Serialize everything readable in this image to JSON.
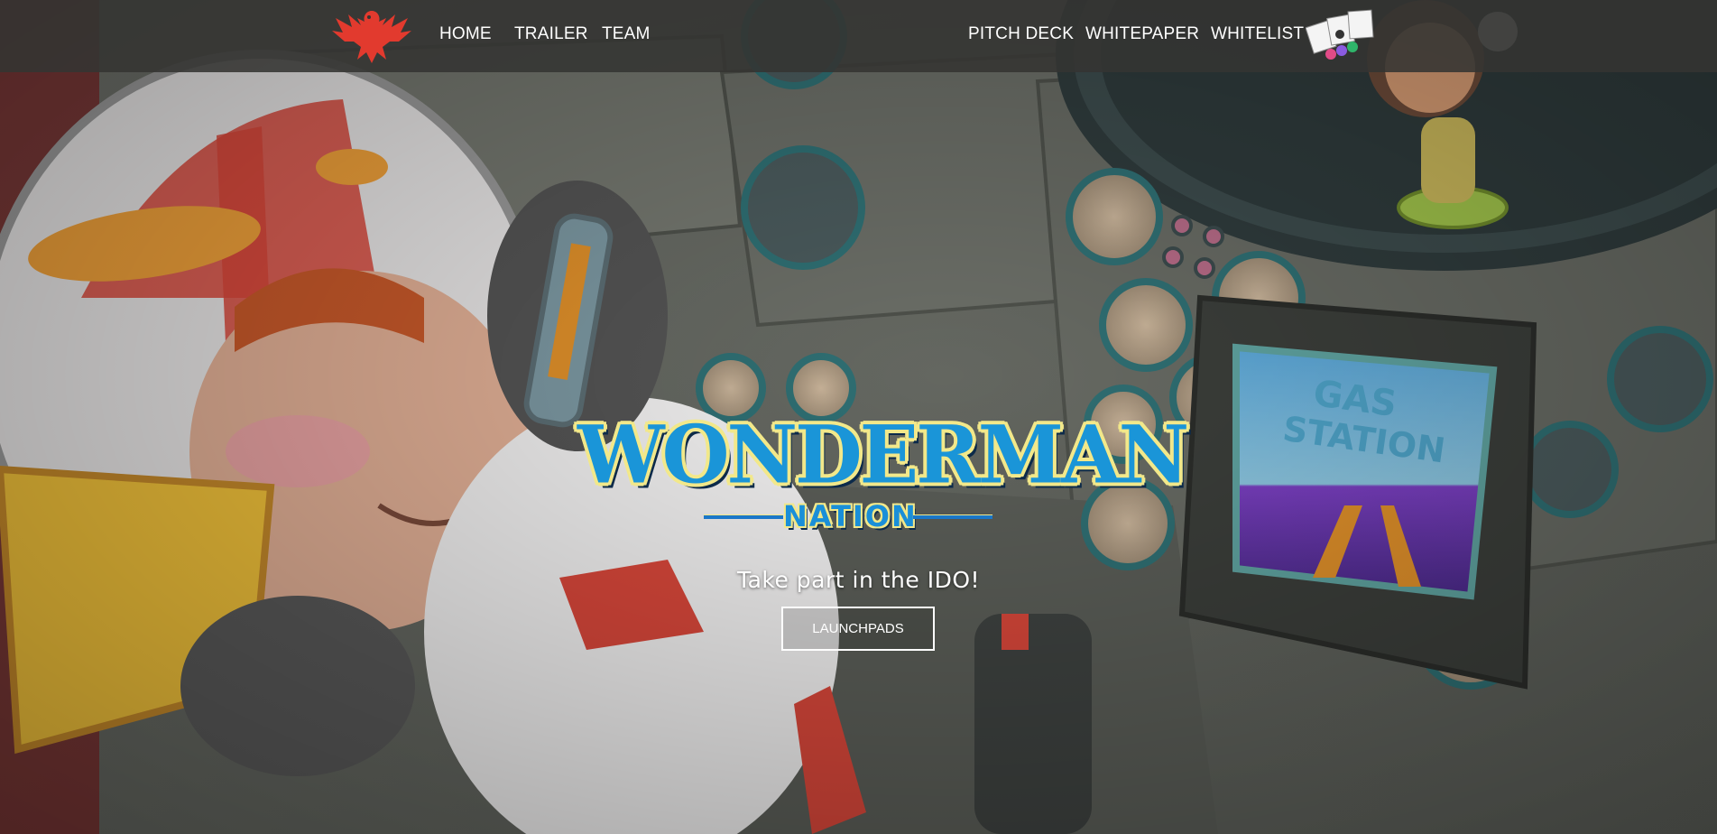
{
  "nav": {
    "links": [
      {
        "label": "HOME"
      },
      {
        "label": "TRAILER"
      },
      {
        "label": "TEAM"
      },
      {
        "label": "PITCH DECK"
      },
      {
        "label": "WHITEPAPER"
      },
      {
        "label": "WHITELIST"
      }
    ],
    "logo_icon": "red-eagle-logo",
    "partner_icons": "partner-logos-icon"
  },
  "hero": {
    "title": "WONDERMAN",
    "subtitle": "NATION",
    "tagline": "Take part in the IDO!",
    "cta_label": "LAUNCHPADS"
  },
  "colors": {
    "accent_red": "#e23a2e",
    "title_blue": "#1a95d8",
    "title_outline": "#f2e88a",
    "nav_bg": "#343432"
  }
}
